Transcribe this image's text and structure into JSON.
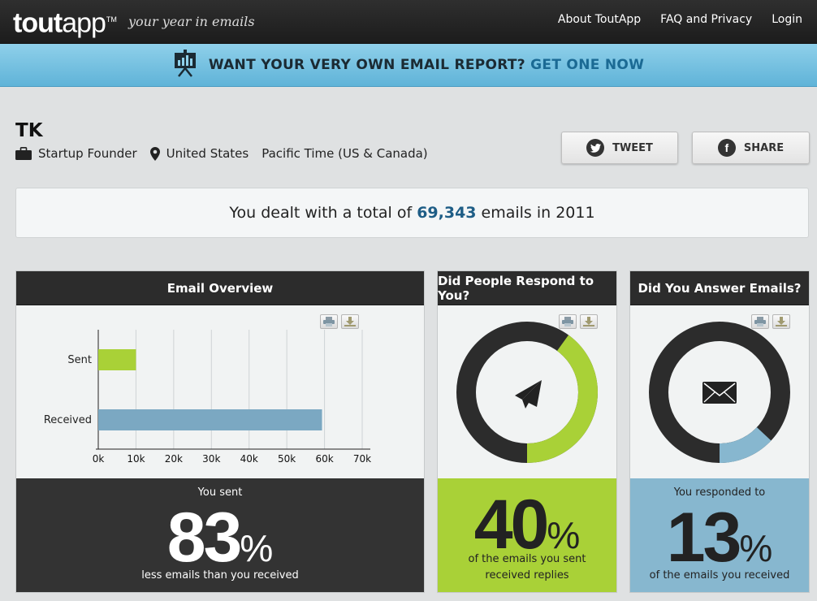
{
  "header": {
    "logo_bold": "tout",
    "logo_light": "app",
    "logo_tm": "TM",
    "tagline": "your year in emails",
    "nav": [
      "About ToutApp",
      "FAQ and Privacy",
      "Login"
    ]
  },
  "banner": {
    "text": "WANT YOUR VERY OWN EMAIL REPORT?",
    "link": "GET ONE NOW",
    "icon": "chart-board-icon"
  },
  "profile": {
    "name": "TK",
    "role": "Startup Founder",
    "location": "United States",
    "timezone": "Pacific Time (US & Canada)"
  },
  "social": {
    "tweet": "TWEET",
    "share": "SHARE"
  },
  "total": {
    "prefix": "You dealt with a total of",
    "count": "69,343",
    "suffix": "emails in 2011"
  },
  "panels": {
    "overview": {
      "title": "Email Overview",
      "label_top": "You sent",
      "value": "83",
      "unit": "%",
      "label_bottom": "less emails than you received"
    },
    "respond": {
      "title": "Did People Respond to You?",
      "value": "40",
      "unit": "%",
      "label_line1": "of the emails you sent",
      "label_line2": "received replies",
      "fraction": 0.4,
      "color": "#a9d137"
    },
    "answer": {
      "title": "Did You Answer Emails?",
      "label_top": "You responded to",
      "value": "13",
      "unit": "%",
      "label_bottom": "of the emails you received",
      "fraction": 0.13,
      "color": "#87b7cf"
    }
  },
  "colors": {
    "sent": "#a9d137",
    "received": "#7ba8c2",
    "ring_dark": "#2c2c2c",
    "link_blue": "#1e5d86"
  },
  "chart_data": {
    "type": "bar",
    "orientation": "horizontal",
    "categories": [
      "Sent",
      "Received"
    ],
    "values": [
      10000,
      59343
    ],
    "xticks": [
      "0k",
      "10k",
      "20k",
      "30k",
      "40k",
      "50k",
      "60k",
      "70k"
    ],
    "xlim": [
      0,
      70000
    ],
    "grid": true
  }
}
